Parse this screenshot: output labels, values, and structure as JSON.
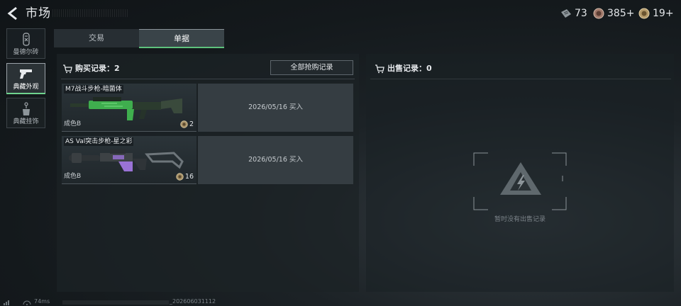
{
  "header": {
    "title": "市场",
    "currencies": [
      {
        "icon": "ticket-icon",
        "value": "73"
      },
      {
        "icon": "coin-icon",
        "value": "385+"
      },
      {
        "icon": "gold-coin-icon",
        "value": "19+"
      }
    ]
  },
  "sidebar": {
    "items": [
      {
        "label": "曼德尔砖",
        "icon": "brick-icon",
        "active": false
      },
      {
        "label": "典藏外观",
        "icon": "pistol-icon",
        "active": true
      },
      {
        "label": "典藏挂饰",
        "icon": "charm-icon",
        "active": false
      }
    ]
  },
  "tabs": [
    {
      "label": "交易",
      "active": false
    },
    {
      "label": "单据",
      "active": true
    }
  ],
  "buy": {
    "title": "购买记录：2",
    "all_button": "全部抢购记录",
    "records": [
      {
        "name": "M7战斗步枪-暗菌体",
        "grade": "成色B",
        "qty": "2",
        "info": "2026/05/16 买入",
        "accent": "#3fae4e"
      },
      {
        "name": "AS Val突击步枪-星之彩",
        "grade": "成色B",
        "qty": "16",
        "info": "2026/05/16 买入",
        "accent": "#9a72d6"
      }
    ]
  },
  "sell": {
    "title": "出售记录：0",
    "empty_text": "暂时没有出售记录"
  },
  "status": {
    "ping": "74ms",
    "build": "_202606031112"
  }
}
